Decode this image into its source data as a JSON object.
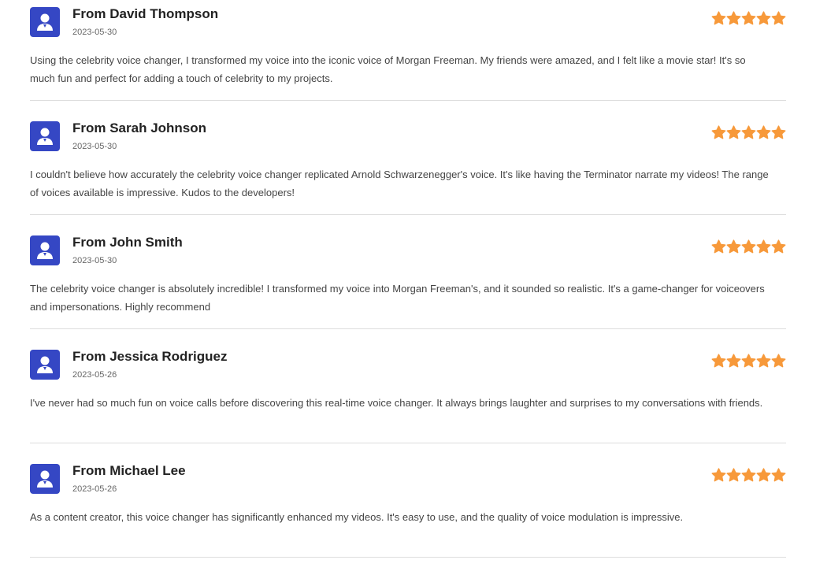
{
  "star_color": "#f7993a",
  "avatar_color": "#3547c4",
  "reviews": [
    {
      "name": "From David Thompson",
      "date": "2023-05-30",
      "rating": 5,
      "text": "Using the celebrity voice changer, I transformed my voice into the iconic voice of Morgan Freeman. My friends were amazed, and I felt like a movie star! It's so much fun and perfect for adding a touch of celebrity to my projects."
    },
    {
      "name": "From Sarah Johnson",
      "date": "2023-05-30",
      "rating": 5,
      "text": "I couldn't believe how accurately the celebrity voice changer replicated Arnold Schwarzenegger's voice. It's like having the Terminator narrate my videos! The range of voices available is impressive. Kudos to the developers!"
    },
    {
      "name": "From John Smith",
      "date": "2023-05-30",
      "rating": 5,
      "text": "The celebrity voice changer is absolutely incredible! I transformed my voice into Morgan Freeman's, and it sounded so realistic. It's a game-changer for voiceovers and impersonations. Highly recommend"
    },
    {
      "name": "From Jessica Rodriguez",
      "date": "2023-05-26",
      "rating": 5,
      "text": "I've never had so much fun on voice calls before discovering this real-time voice changer. It always brings laughter and surprises to my conversations with friends."
    },
    {
      "name": "From Michael Lee",
      "date": "2023-05-26",
      "rating": 5,
      "text": "As a content creator, this voice changer has significantly enhanced my videos. It's easy to use, and the quality of voice modulation is impressive."
    }
  ]
}
